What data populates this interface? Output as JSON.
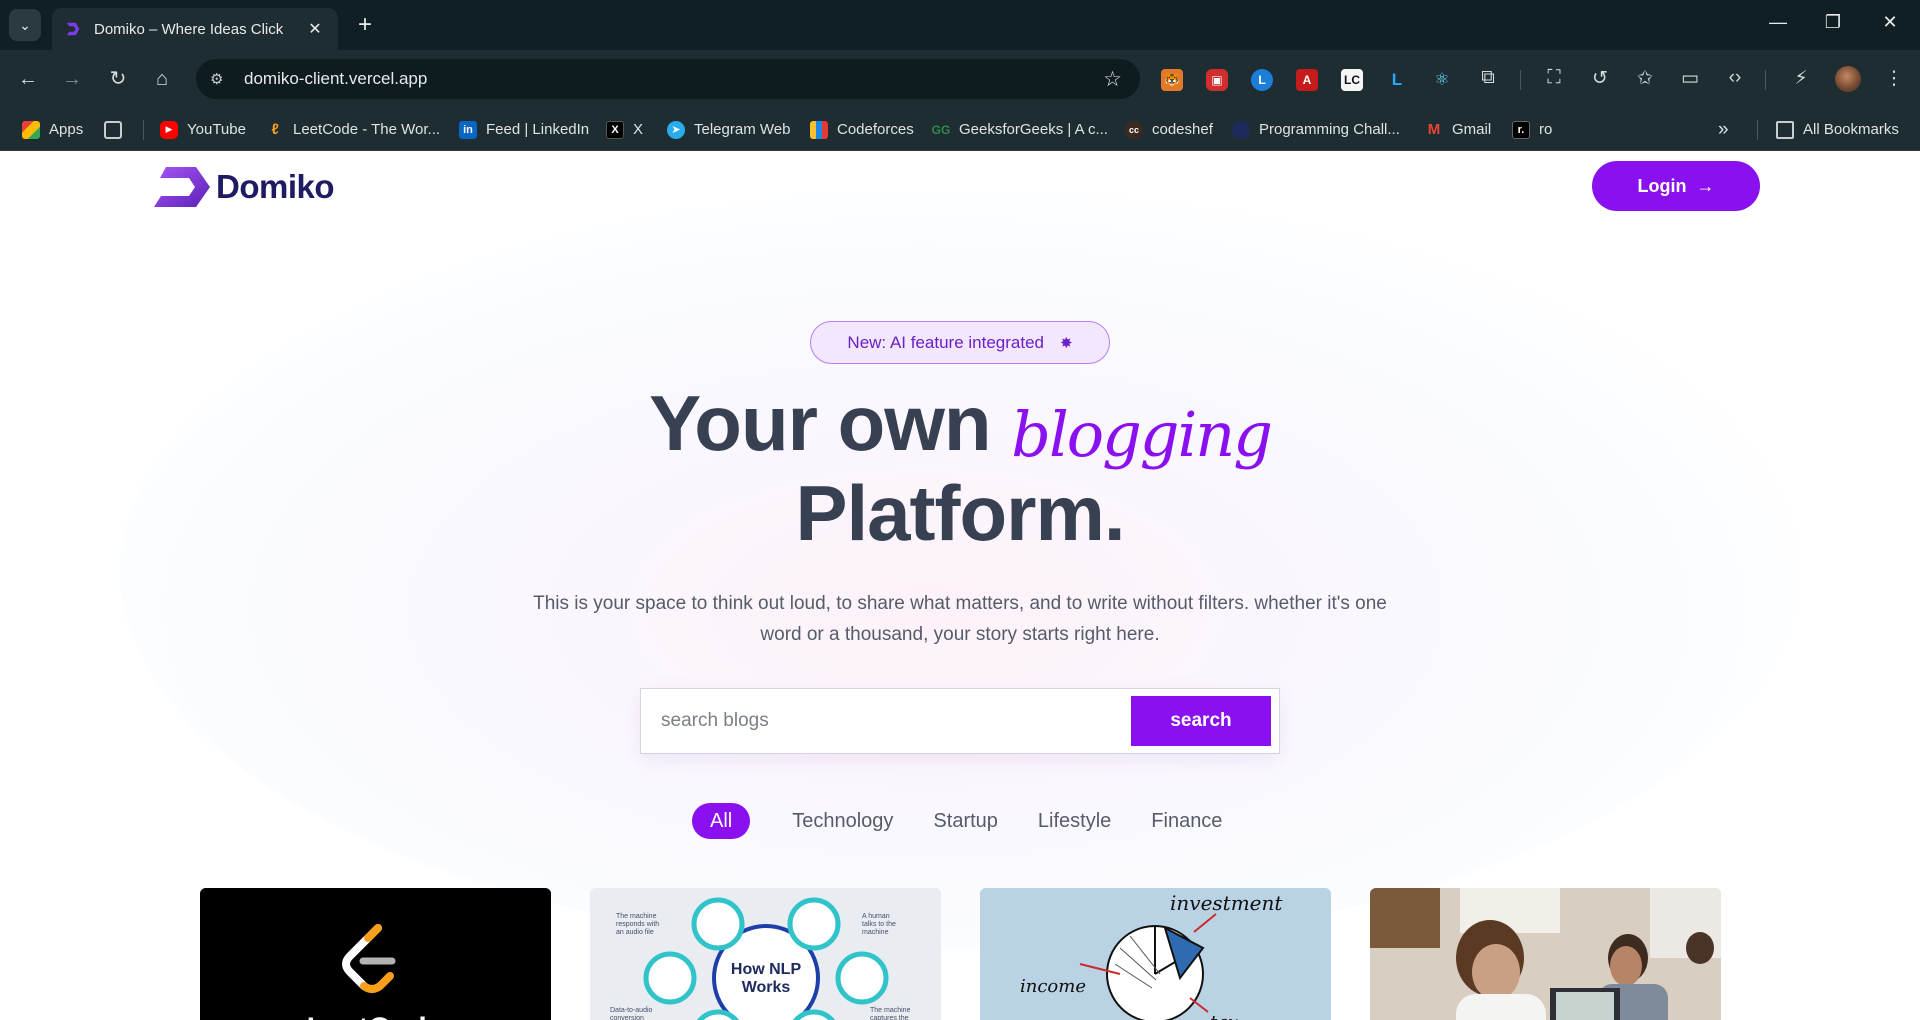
{
  "browser": {
    "tab_title": "Domiko – Where Ideas Click",
    "url": "domiko-client.vercel.app",
    "bookmarks": [
      {
        "label": "Apps",
        "icon": "apps-grid-icon"
      },
      {
        "label": "",
        "icon": "tab-groups-icon"
      },
      {
        "label": "YouTube",
        "icon": "youtube-icon"
      },
      {
        "label": "LeetCode - The Wor...",
        "icon": "leetcode-icon"
      },
      {
        "label": "Feed | LinkedIn",
        "icon": "linkedin-icon"
      },
      {
        "label": "X",
        "icon": "x-icon"
      },
      {
        "label": "Telegram Web",
        "icon": "telegram-icon"
      },
      {
        "label": "Codeforces",
        "icon": "codeforces-icon"
      },
      {
        "label": "GeeksforGeeks | A c...",
        "icon": "geeksforgeeks-icon"
      },
      {
        "label": "codeshef",
        "icon": "codechef-icon"
      },
      {
        "label": "Programming Chall...",
        "icon": "programming-challenges-icon"
      },
      {
        "label": "Gmail",
        "icon": "gmail-icon"
      },
      {
        "label": "ro",
        "icon": "ro-icon"
      }
    ],
    "all_bookmarks": "All Bookmarks"
  },
  "site": {
    "brand": "Domiko",
    "login_label": "Login",
    "badge": "New: AI feature integrated",
    "hero_line1": "Your own",
    "hero_script": "blogging",
    "hero_line2": "Platform.",
    "subtext": "This is your space to think out loud, to share what matters, and to write without filters. whether it's one word or a thousand, your story starts right here.",
    "search_placeholder": "search blogs",
    "search_button": "search",
    "categories": [
      "All",
      "Technology",
      "Startup",
      "Lifestyle",
      "Finance"
    ],
    "active_category": "All",
    "accent_color": "#8b10f0",
    "cards": [
      {
        "image": "leetcode-logo-image",
        "visible_text": "LeetCode"
      },
      {
        "image": "nlp-diagram-image",
        "visible_text": "How NLP Works",
        "annotations": [
          "The machine responds with an audio file",
          "A human talks to the machine",
          "Data-to-audio conversion",
          "The machine captures the audio"
        ]
      },
      {
        "image": "investment-pie-sketch-image",
        "annotations": [
          "investment",
          "income",
          "tax"
        ]
      },
      {
        "image": "team-meeting-photo"
      }
    ]
  }
}
